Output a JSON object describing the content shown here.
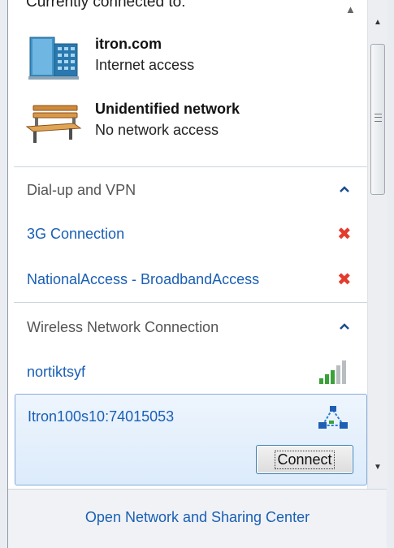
{
  "connected": {
    "header_partial": "Currently connected to:",
    "networks": [
      {
        "name": "itron.com",
        "status": "Internet access",
        "icon": "domain-network-icon"
      },
      {
        "name": "Unidentified network",
        "status": "No network access",
        "icon": "public-network-bench-icon"
      }
    ]
  },
  "dialup": {
    "title": "Dial-up and VPN",
    "items": [
      {
        "label": "3G Connection",
        "status_icon": "disconnected-x-icon"
      },
      {
        "label": "NationalAccess - BroadbandAccess",
        "status_icon": "disconnected-x-icon"
      }
    ]
  },
  "wireless": {
    "title": "Wireless Network Connection",
    "items": [
      {
        "label": "nortiktsyf",
        "icon": "signal-strength-icon"
      },
      {
        "label": "Itron100s10:74015053",
        "icon": "adhoc-network-icon",
        "selected": true
      }
    ],
    "connect_button": "Connect"
  },
  "footer": {
    "link": "Open Network and Sharing Center"
  },
  "colors": {
    "link": "#1a5fb4",
    "disconnected": "#e53a2e",
    "signal": "#2e9d2e",
    "selection": "#dcebfb"
  }
}
